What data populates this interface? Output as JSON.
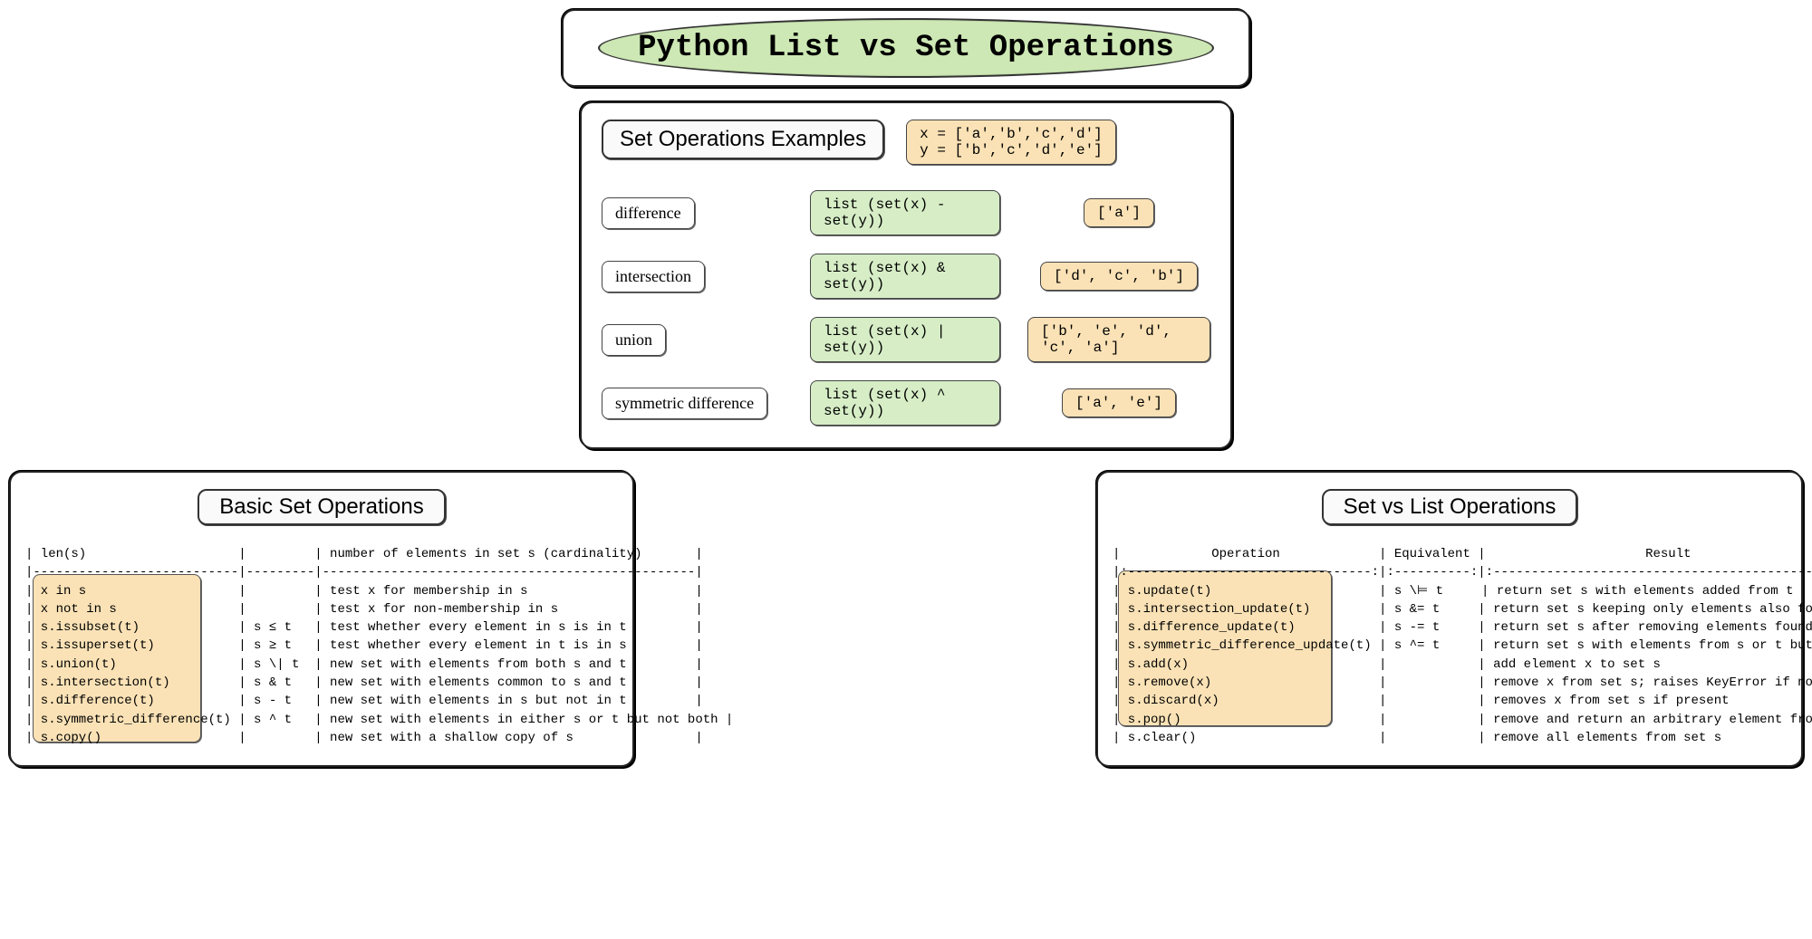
{
  "title": "Python List vs Set Operations",
  "examples": {
    "heading": "Set Operations Examples",
    "setup": "x = ['a','b','c','d']\ny = ['b','c','d','e']",
    "rows": [
      {
        "name": "difference",
        "expr": "list (set(x) - set(y))",
        "result": "['a']"
      },
      {
        "name": "intersection",
        "expr": "list (set(x) & set(y))",
        "result": "['d', 'c', 'b']"
      },
      {
        "name": "union",
        "expr": "list (set(x) | set(y))",
        "result": "['b', 'e', 'd', 'c', 'a']"
      },
      {
        "name": "symmetric difference",
        "expr": "list (set(x) ^ set(y))",
        "result": "['a', 'e']"
      }
    ]
  },
  "basic": {
    "heading": "Basic Set Operations",
    "text": "| len(s)                    |         | number of elements in set s (cardinality)       |\n|---------------------------|---------|-------------------------------------------------|\n| x in s                    |         | test x for membership in s                      |\n| x not in s                |         | test x for non-membership in s                  |\n| s.issubset(t)             | s ≤ t   | test whether every element in s is in t         |\n| s.issuperset(t)           | s ≥ t   | test whether every element in t is in s         |\n| s.union(t)                | s \\| t  | new set with elements from both s and t         |\n| s.intersection(t)         | s & t   | new set with elements common to s and t         |\n| s.difference(t)           | s - t   | new set with elements in s but not in t         |\n| s.symmetric_difference(t) | s ^ t   | new set with elements in either s or t but not both |\n| s.copy()                  |         | new set with a shallow copy of s                |"
  },
  "setvslist": {
    "heading": "Set vs List Operations",
    "text": "|            Operation             | Equivalent |                     Result                        |\n|:--------------------------------:|:----------:|:-------------------------------------------------:|\n| s.update(t)                      | s \\⊨ t     | return set s with elements added from t           |\n| s.intersection_update(t)         | s &= t     | return set s keeping only elements also found in t |\n| s.difference_update(t)           | s -= t     | return set s after removing elements found in t   |\n| s.symmetric_difference_update(t) | s ^= t     | return set s with elements from s or t but not both |\n| s.add(x)                         |            | add element x to set s                            |\n| s.remove(x)                      |            | remove x from set s; raises KeyError if not present |\n| s.discard(x)                     |            | removes x from set s if present                   |\n| s.pop()                          |            | remove and return an arbitrary element from s;    |\n| s.clear()                        |            | remove all elements from set s                    |"
  }
}
